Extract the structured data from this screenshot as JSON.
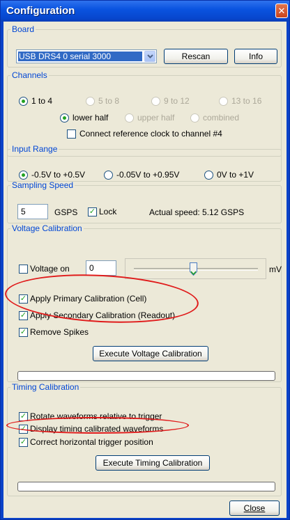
{
  "window": {
    "title": "Configuration",
    "close_glyph": "✕"
  },
  "board": {
    "legend": "Board",
    "selected": "USB DRS4 0 serial 3000",
    "rescan_label": "Rescan",
    "info_label": "Info"
  },
  "channels": {
    "legend": "Channels",
    "options": [
      "1 to 4",
      "5 to 8",
      "9 to 12",
      "13 to 16"
    ],
    "selected_option": "1 to 4",
    "halves": [
      "lower half",
      "upper half",
      "combined"
    ],
    "selected_half": "lower half",
    "reference_clock_label": "Connect reference clock to channel #4",
    "reference_clock_checked": false
  },
  "input_range": {
    "legend": "Input Range",
    "options": [
      "-0.5V to +0.5V",
      "-0.05V to +0.95V",
      "0V to +1V"
    ],
    "selected_option": "-0.5V to +0.5V"
  },
  "sampling": {
    "legend": "Sampling Speed",
    "value": "5",
    "unit": "GSPS",
    "lock_label": "Lock",
    "lock_checked": true,
    "actual_speed": "Actual speed: 5.12 GSPS"
  },
  "voltage_cal": {
    "legend": "Voltage Calibration",
    "voltage_on_label": "Voltage on",
    "voltage_on_checked": false,
    "voltage_value": "0",
    "unit": "mV",
    "slider_position": 0.48,
    "primary_label": "Apply Primary Calibration (Cell)",
    "primary_checked": true,
    "secondary_label": "Apply Secondary Calibration (Readout)",
    "secondary_checked": true,
    "spikes_label": "Remove Spikes",
    "spikes_checked": true,
    "execute_label": "Execute Voltage Calibration",
    "progress": 0
  },
  "timing_cal": {
    "legend": "Timing Calibration",
    "rotate_label": "Rotate waveforms relative to trigger",
    "rotate_checked": true,
    "display_label": "Display timing calibrated waveforms",
    "display_checked": true,
    "correct_label": "Correct horizontal trigger position",
    "correct_checked": true,
    "execute_label": "Execute Timing Calibration",
    "progress": 0
  },
  "footer": {
    "close_label": "Close"
  },
  "colors": {
    "titlebar": "#0a54e0",
    "dialog_bg": "#ece9d8",
    "legend": "#0046d5",
    "annotation": "#e01a1a",
    "radio_dot": "#21a121"
  }
}
